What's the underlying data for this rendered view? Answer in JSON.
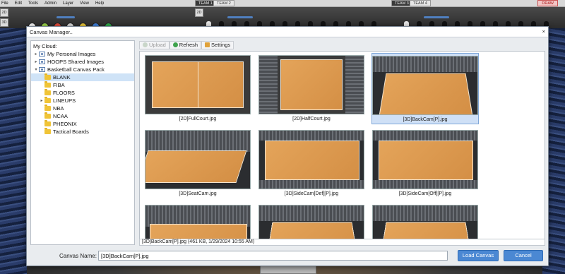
{
  "app": {
    "menu": [
      "File",
      "Edit",
      "Tools",
      "Admin",
      "Layer",
      "View",
      "Help"
    ],
    "team_tabs": [
      "TEAM 1",
      "TEAM 2",
      "TEAM 3",
      "TEAM 4"
    ],
    "draw_label": "DRAW",
    "view_buttons": [
      "2D",
      "3D",
      "2D"
    ]
  },
  "dialog": {
    "title": "Canvas Manager..",
    "close_glyph": "×",
    "tree": {
      "root_label": "My Cloud:",
      "items": [
        {
          "label": "My Personal Images",
          "kind": "shared",
          "twisty": "▸",
          "level": 0
        },
        {
          "label": "HOOPS Shared Images",
          "kind": "shared",
          "twisty": "▸",
          "level": 0
        },
        {
          "label": "Basketball Canvas Pack",
          "kind": "shared",
          "twisty": "▾",
          "level": 0
        },
        {
          "label": "BLANK",
          "kind": "folder",
          "twisty": "",
          "level": 1,
          "selected": true
        },
        {
          "label": "FIBA",
          "kind": "folder",
          "twisty": "",
          "level": 1
        },
        {
          "label": "FLOORS",
          "kind": "folder",
          "twisty": "",
          "level": 1
        },
        {
          "label": "LINEUPS",
          "kind": "folder",
          "twisty": "▸",
          "level": 1
        },
        {
          "label": "NBA",
          "kind": "folder",
          "twisty": "",
          "level": 1
        },
        {
          "label": "NCAA",
          "kind": "folder",
          "twisty": "",
          "level": 1
        },
        {
          "label": "PHEONIX",
          "kind": "folder",
          "twisty": "",
          "level": 1
        },
        {
          "label": "Tactical Boards",
          "kind": "folder",
          "twisty": "",
          "level": 1
        }
      ]
    },
    "toolbar": {
      "upload": "Upload",
      "refresh": "Refresh",
      "settings": "Settings"
    },
    "images": [
      {
        "name": "[2D]FullCourt.jpg",
        "style": "2d-full"
      },
      {
        "name": "[2D]HalfCourt.jpg",
        "style": "2d-half"
      },
      {
        "name": "[3D]BackCam[P].jpg",
        "style": "3d-back",
        "selected": true
      },
      {
        "name": "[3D]SeatCam.jpg",
        "style": "3d-seat"
      },
      {
        "name": "[3D]SideCam[Def][P].jpg",
        "style": "3d-side"
      },
      {
        "name": "[3D]SideCam[Off][P].jpg",
        "style": "3d-side"
      },
      {
        "name": "",
        "style": "3d-low"
      },
      {
        "name": "",
        "style": "3d-back"
      },
      {
        "name": "",
        "style": "3d-back"
      }
    ],
    "info": "[3D]BackCam[P].jpg (461 KB, 1/29/2024 10:55 AM)",
    "canvas_name_label": "Canvas Name:",
    "canvas_name_value": "[3D]BackCam[P].jpg",
    "load_button": "Load Canvas",
    "cancel_button": "Cancel"
  },
  "colors": {
    "accent": "#4b88d3",
    "selection": "#cfe3f7",
    "court": "#d9954a"
  }
}
